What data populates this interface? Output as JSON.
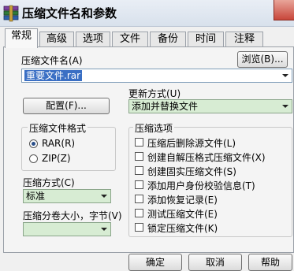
{
  "window": {
    "title": "压缩文件名和参数"
  },
  "tabs": [
    {
      "label": "常规",
      "active": true
    },
    {
      "label": "高级",
      "active": false
    },
    {
      "label": "选项",
      "active": false
    },
    {
      "label": "文件",
      "active": false
    },
    {
      "label": "备份",
      "active": false
    },
    {
      "label": "时间",
      "active": false
    },
    {
      "label": "注释",
      "active": false
    }
  ],
  "general": {
    "archive_name_label": "压缩文件名(A)",
    "archive_name_value": "重要文件.rar",
    "browse_button": "浏览(B)...",
    "profiles_button": "配置(F)...",
    "update_mode_label": "更新方式(U)",
    "update_mode_value": "添加并替换文件",
    "format_group_title": "压缩文件格式",
    "format_options": [
      {
        "label": "RAR(R)",
        "checked": true
      },
      {
        "label": "ZIP(Z)",
        "checked": false
      }
    ],
    "method_label": "压缩方式(C)",
    "method_value": "标准",
    "split_label": "压缩分卷大小，字节(V)",
    "split_value": "",
    "options_group_title": "压缩选项",
    "options": [
      {
        "label": "压缩后删除源文件(L)",
        "checked": false
      },
      {
        "label": "创建自解压格式压缩文件(X)",
        "checked": false
      },
      {
        "label": "创建固实压缩文件(S)",
        "checked": false
      },
      {
        "label": "添加用户身份校验信息(T)",
        "checked": false
      },
      {
        "label": "添加恢复记录(E)",
        "checked": false
      },
      {
        "label": "测试压缩文件(E)",
        "checked": false
      },
      {
        "label": "锁定压缩文件(K)",
        "checked": false
      }
    ]
  },
  "buttons": {
    "ok": "确定",
    "cancel": "取消",
    "help": "帮助"
  },
  "colors": {
    "field_bg": "#d7ecd3",
    "selection_bg": "#3a6fc4"
  }
}
